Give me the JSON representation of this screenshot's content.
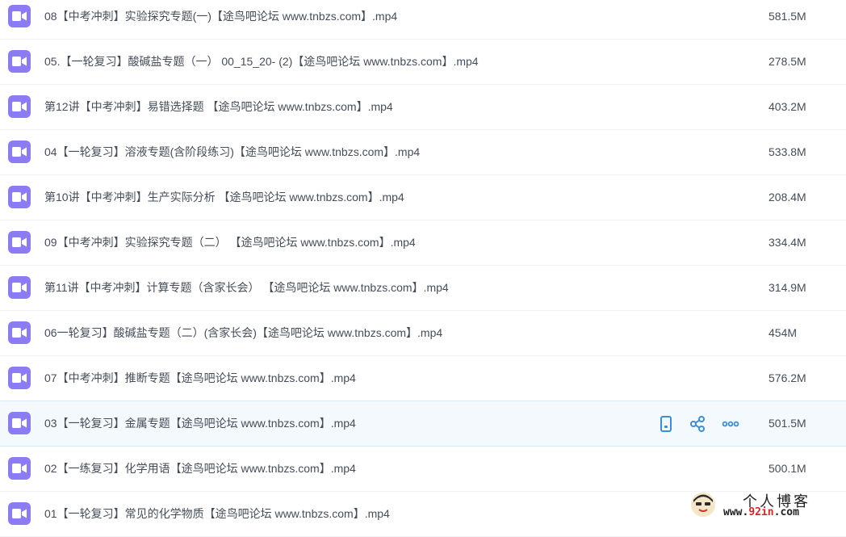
{
  "files": [
    {
      "name": "08【中考冲刺】实验探究专题(一)【途鸟吧论坛 www.tnbzs.com】.mp4",
      "size": "581.5M"
    },
    {
      "name": "05.【一轮复习】酸碱盐专题（一） 00_15_20- (2)【途鸟吧论坛 www.tnbzs.com】.mp4",
      "size": "278.5M"
    },
    {
      "name": "第12讲【中考冲刺】易错选择题 【途鸟吧论坛 www.tnbzs.com】.mp4",
      "size": "403.2M"
    },
    {
      "name": "04【一轮复习】溶液专题(含阶段练习)【途鸟吧论坛 www.tnbzs.com】.mp4",
      "size": "533.8M"
    },
    {
      "name": "第10讲【中考冲刺】生产实际分析 【途鸟吧论坛 www.tnbzs.com】.mp4",
      "size": "208.4M"
    },
    {
      "name": "09【中考冲刺】实验探究专题（二） 【途鸟吧论坛 www.tnbzs.com】.mp4",
      "size": "334.4M"
    },
    {
      "name": "第11讲【中考冲刺】计算专题（含家长会） 【途鸟吧论坛 www.tnbzs.com】.mp4",
      "size": "314.9M"
    },
    {
      "name": "06一轮复习】酸碱盐专题（二）(含家长会)【途鸟吧论坛 www.tnbzs.com】.mp4",
      "size": "454M"
    },
    {
      "name": "07【中考冲刺】推断专题【途鸟吧论坛 www.tnbzs.com】.mp4",
      "size": "576.2M"
    },
    {
      "name": "03【一轮复习】金属专题【途鸟吧论坛 www.tnbzs.com】.mp4",
      "size": "501.5M"
    },
    {
      "name": "02【一练复习】化学用语【途鸟吧论坛 www.tnbzs.com】.mp4",
      "size": "500.1M"
    },
    {
      "name": "01【一轮复习】常见的化学物质【途鸟吧论坛 www.tnbzs.com】.mp4",
      "size": ""
    }
  ],
  "hovered_row_index": 9,
  "row_actions": [
    "phone-icon",
    "share-icon",
    "more-icon"
  ],
  "watermark": {
    "title": "个人博客",
    "url_prefix": "www.",
    "url_accent": "92in",
    "url_suffix": ".com"
  },
  "colors": {
    "video_icon_bg": "#8b7cf6",
    "action_icon": "#3b8fd9",
    "hover_bg": "#f4f9fe",
    "text": "#454d5a",
    "watermark_accent": "#d8232a"
  }
}
